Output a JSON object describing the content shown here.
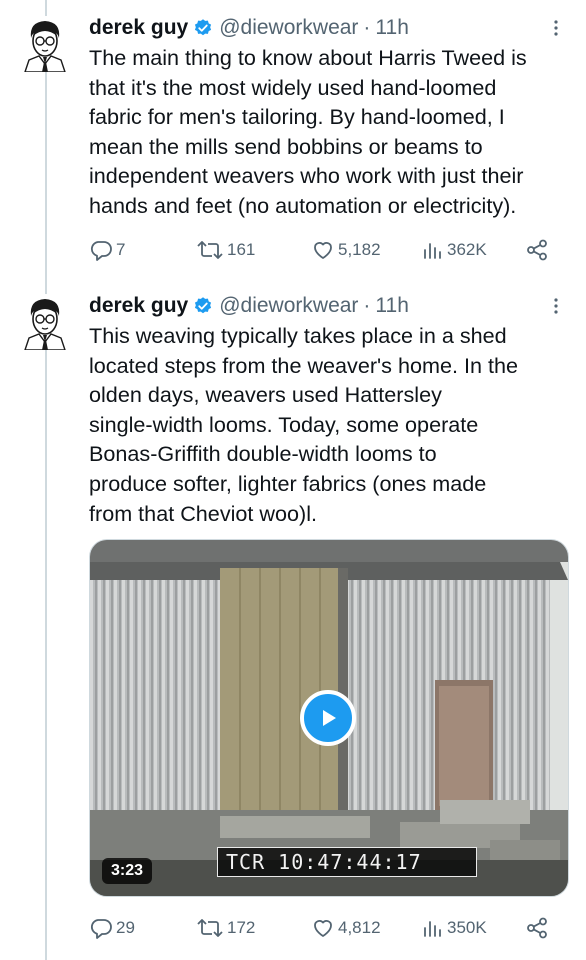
{
  "tweets": [
    {
      "author_name": "derek guy",
      "handle": "@dieworkwear",
      "separator": "·",
      "time": "11h",
      "text": "The main thing to know about Harris Tweed is\nthat it's the most widely used hand-loomed\nfabric for men's tailoring. By hand-loomed, I\nmean the mills send bobbins or beams to\nindependent weavers who work with just their\nhands and feet (no automation or electricity).",
      "replies": "7",
      "retweets": "161",
      "likes": "5,182",
      "views": "362K"
    },
    {
      "author_name": "derek guy",
      "handle": "@dieworkwear",
      "separator": "·",
      "time": "11h",
      "text": "This weaving typically takes place in a shed\nlocated steps from the weaver's home. In the\nolden days, weavers used Hattersley\nsingle-width looms. Today, some operate\nBonas-Griffith double-width looms to\nproduce softer, lighter fabrics (ones made\nfrom that Cheviot woo)l.",
      "video": {
        "duration": "3:23",
        "overlay_text": "TCR 10:47:44:17"
      },
      "replies": "29",
      "retweets": "172",
      "likes": "4,812",
      "views": "350K"
    }
  ],
  "colors": {
    "accent": "#1d9bf0",
    "text": "#0f1419",
    "secondary": "#536471",
    "divider": "#cfd9de"
  },
  "icons": [
    "verified-badge-icon",
    "more-options-icon",
    "reply-icon",
    "retweet-icon",
    "like-icon",
    "views-icon",
    "share-icon",
    "play-icon"
  ]
}
